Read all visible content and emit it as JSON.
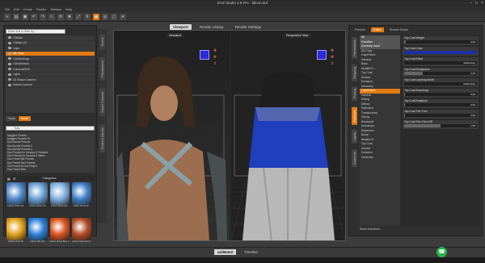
{
  "window": {
    "title": "DAZ Studio 4.8 Pro - falcon.duf",
    "minimize": "–",
    "maximize": "□",
    "close": "×"
  },
  "menu": [
    "File",
    "Edit",
    "Create",
    "Render",
    "Window",
    "Help"
  ],
  "toolbar_icons": [
    "file-new-icon",
    "open-icon",
    "save-icon",
    "undo-icon",
    "redo-icon",
    "select-icon",
    "rotate-icon",
    "translate-icon",
    "scale-icon",
    "joint-editor-icon",
    "node-weight-icon",
    "geometry-editor-icon",
    "render-icon",
    "spot-render-icon",
    "camera-icon",
    "light-icon"
  ],
  "left": {
    "filter_placeholder": "Enter text to filter by...",
    "scene_items": [
      {
        "label": "G3Male",
        "selected": false
      },
      {
        "label": "G3Male (2)",
        "selected": false
      },
      {
        "label": "Cape",
        "selected": false
      },
      {
        "label": "AB Cape",
        "selected": true
      },
      {
        "label": "ClothSettings",
        "selected": false
      },
      {
        "label": "G3Hairbands",
        "selected": false
      },
      {
        "label": "Columns0029",
        "selected": false
      },
      {
        "label": "Lights",
        "selected": false
      },
      {
        "label": "3D Shape Camera",
        "selected": false
      },
      {
        "label": "Default Camera",
        "selected": false
      }
    ],
    "scene_buttons": {
      "a": "Tools",
      "b": "Node"
    },
    "search_value": "Kay",
    "results": [
      "Daggers Presets",
      "Daggers Presets Ex",
      "Daz Bundle Presets",
      "Daz Bundle Presets 2",
      "Daz Bundle Presets 3",
      "Daz Presets for Genesis 3 Females",
      "Daz Presets for Genesis 3 Males",
      "Daz Preset Bld Presets",
      "Daz Preset Skin Presets",
      "Daz Preset for Kia Project",
      "Daz Preset Sets"
    ],
    "thumb_header": "Categories",
    "thumbs": [
      {
        "label": "Fabric Cotton 2K",
        "color": "#4e86c8"
      },
      {
        "label": "Fabric Denim 2K",
        "color": "#6aa0d4"
      },
      {
        "label": "Fabric Wool (2K)",
        "color": "#7fb0e0"
      },
      {
        "label": "Fabric Velvet 2K",
        "color": "#3f7fc6"
      },
      {
        "label": "Fabric Linen 2K",
        "color": "#e0a01a"
      },
      {
        "label": "Fabric Silk (2K)",
        "color": "#2d7fd8"
      },
      {
        "label": "Fabric Velvet Blue 4",
        "color": "#d9521f"
      },
      {
        "label": "Fabric Satin Red 8",
        "color": "#b34a23"
      }
    ],
    "vtabs": [
      "Scene",
      "Parameters",
      "Smart Content",
      "Content Library"
    ]
  },
  "viewport": {
    "tabs": [
      {
        "label": "Viewport",
        "active": true
      },
      {
        "label": "Render Library",
        "active": false
      },
      {
        "label": "Render Settings",
        "active": false
      }
    ],
    "left_cam": "Headshot",
    "right_cam": "Perspective View"
  },
  "right": {
    "tabs": [
      {
        "label": "Presets",
        "active": false
      },
      {
        "label": "Editor",
        "active": true
      },
      {
        "label": "Shader Baker",
        "active": false
      }
    ],
    "vtabs": [
      {
        "label": "Parameters",
        "active": false
      },
      {
        "label": "Shaping",
        "active": false
      },
      {
        "label": "Posing",
        "active": false
      },
      {
        "label": "Surfaces",
        "active": true
      },
      {
        "label": "Lights",
        "active": false
      },
      {
        "label": "Cameras",
        "active": false
      }
    ],
    "categories": [
      {
        "label": "All",
        "type": "head"
      },
      {
        "label": "Favorites",
        "type": "head"
      },
      {
        "label": "Currently Used",
        "type": "head"
      },
      {
        "label": "AB Cape",
        "type": "normal"
      },
      {
        "label": "CapeFabric",
        "type": "normal"
      },
      {
        "label": "General",
        "type": "normal"
      },
      {
        "label": "Base",
        "type": "normal"
      },
      {
        "label": "Metallic Fl...",
        "type": "normal"
      },
      {
        "label": "Top Coat",
        "type": "normal"
      },
      {
        "label": "Volume",
        "type": "normal"
      },
      {
        "label": "Emission",
        "type": "normal"
      },
      {
        "label": "Geometry",
        "type": "normal"
      },
      {
        "label": "CapeFabric",
        "type": "sel"
      },
      {
        "label": "General",
        "type": "normal"
      },
      {
        "label": "Mixing",
        "type": "normal"
      },
      {
        "label": "Diffuse",
        "type": "normal"
      },
      {
        "label": "Reflection",
        "type": "normal"
      },
      {
        "label": "Translucency",
        "type": "normal"
      },
      {
        "label": "Glossy",
        "type": "normal"
      },
      {
        "label": "Backscatt.",
        "type": "normal"
      },
      {
        "label": "Anisotropy",
        "type": "normal"
      },
      {
        "label": "Refraction",
        "type": "normal"
      },
      {
        "label": "Bump",
        "type": "normal"
      },
      {
        "label": "Metallic Fl.",
        "type": "normal"
      },
      {
        "label": "Top Coat",
        "type": "normal"
      },
      {
        "label": "Volume",
        "type": "normal"
      },
      {
        "label": "Emission",
        "type": "normal"
      },
      {
        "label": "Geometry",
        "type": "normal"
      }
    ],
    "props": [
      {
        "label": "Top Coat Weight",
        "value": "0.00",
        "fill": 0.02
      },
      {
        "label": "Top Coat Color",
        "value": "",
        "fill": 1.0
      },
      {
        "label": "Top Coat Effect",
        "value": "Reflectivity",
        "fill": 0.0
      },
      {
        "label": "Top Coat Roughness",
        "value": "0.25",
        "fill": 0.25
      },
      {
        "label": "Top Coat Layering Mode",
        "value": "Reflectivity",
        "fill": 0.0
      },
      {
        "label": "Top Coat Anisotropy",
        "value": "0.00",
        "fill": 0.01
      },
      {
        "label": "Top Coat Rotations",
        "value": "0.00",
        "fill": 0.01
      },
      {
        "label": "Top Coat Thin Film",
        "value": "0.00",
        "fill": 0.01
      },
      {
        "label": "Top Coat Thin Film IOR",
        "value": "1.50",
        "fill": 0.5
      }
    ],
    "show_sub": "Show Sub Items"
  },
  "bottom": {
    "tabs": [
      {
        "label": "aniMate2",
        "active": true
      },
      {
        "label": "Timeline",
        "active": false
      }
    ]
  },
  "whatsapp_icon": "☎"
}
